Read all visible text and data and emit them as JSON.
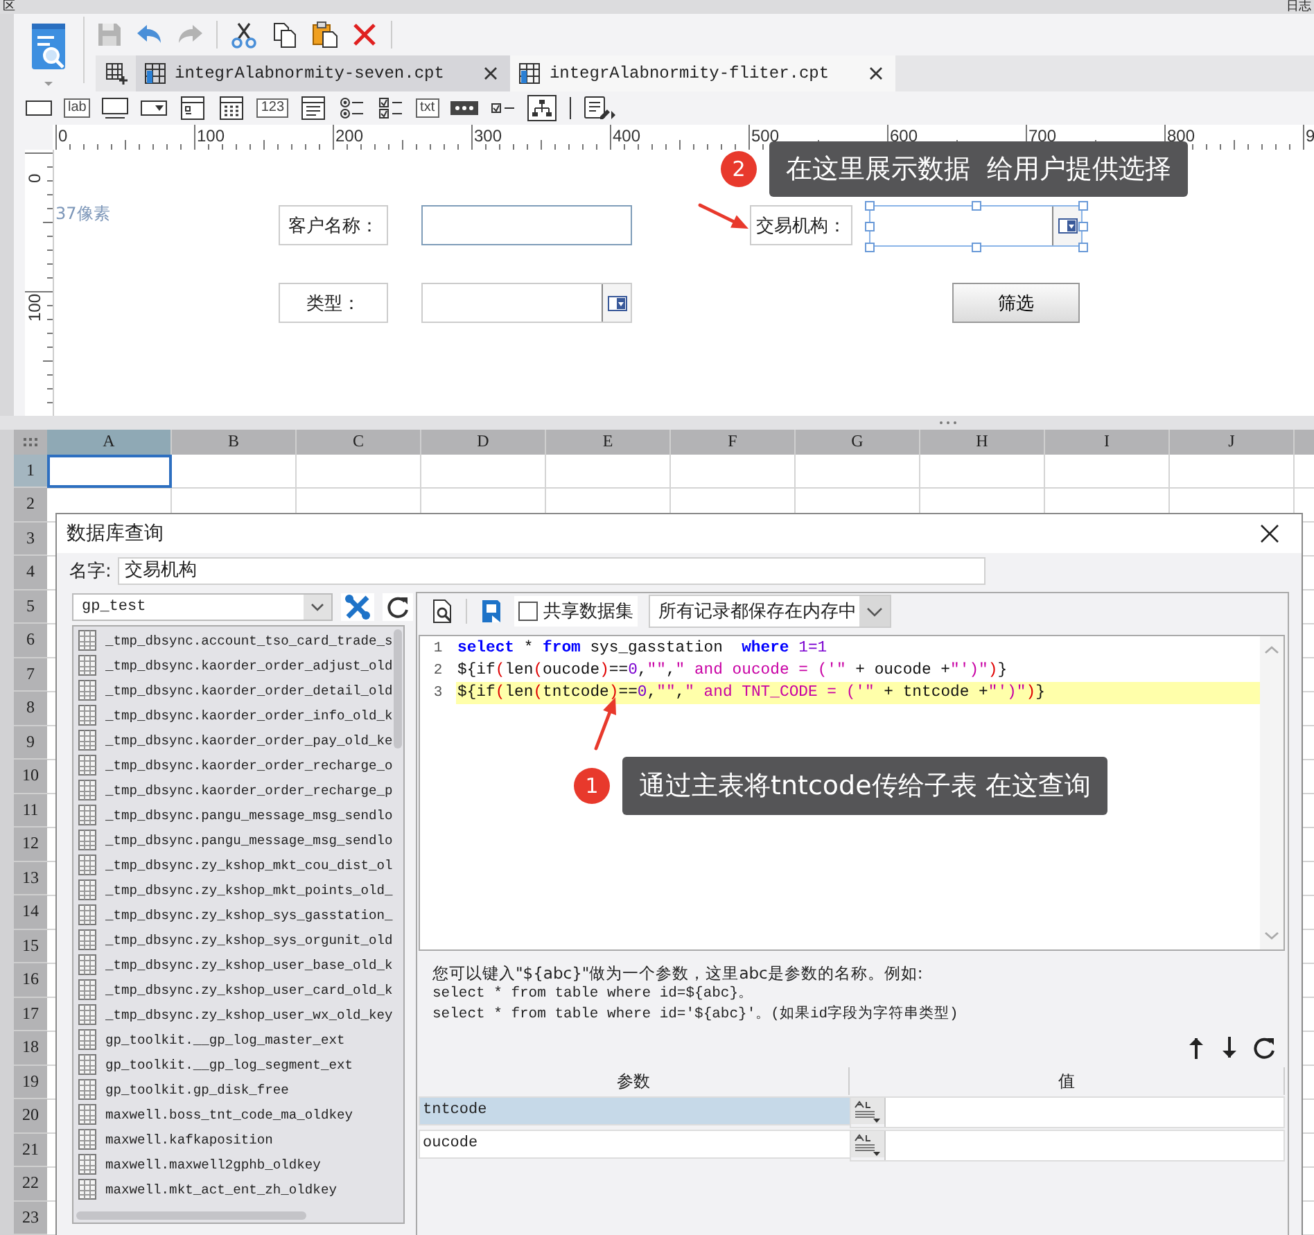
{
  "top_strip": {
    "left_text": "区",
    "right_text": "日志"
  },
  "main_toolbar": [
    {
      "kind": "save",
      "disabled": true
    },
    {
      "kind": "undo",
      "disabled": false
    },
    {
      "kind": "redo",
      "disabled": true
    },
    {
      "kind": "cut",
      "disabled": false
    },
    {
      "kind": "copy",
      "disabled": false
    },
    {
      "kind": "paste",
      "disabled": false
    },
    {
      "kind": "delete",
      "disabled": false
    }
  ],
  "file_tabs": [
    {
      "label": "integrAlabnormity-seven.cpt",
      "selected": false
    },
    {
      "label": "integrAlabnormity-fliter.cpt",
      "selected": true
    }
  ],
  "widget_toolbar": [
    {
      "kind": "text-field"
    },
    {
      "kind": "label",
      "label": "lab"
    },
    {
      "kind": "text-area"
    },
    {
      "kind": "combo"
    },
    {
      "kind": "date-panel"
    },
    {
      "kind": "calendar"
    },
    {
      "kind": "number",
      "label": "123"
    },
    {
      "kind": "list"
    },
    {
      "kind": "radio-group"
    },
    {
      "kind": "checkbox-group"
    },
    {
      "kind": "text",
      "label": "txt"
    },
    {
      "kind": "password"
    },
    {
      "kind": "checkbox"
    },
    {
      "kind": "tree"
    },
    {
      "kind": "separator"
    },
    {
      "kind": "form-edit"
    }
  ],
  "ruler": {
    "x_labels": [
      "0",
      "100",
      "200",
      "300",
      "400",
      "500",
      "600",
      "700",
      "800",
      "9"
    ],
    "y_labels": [
      "0",
      "100"
    ]
  },
  "canvas": {
    "note": "37像素",
    "widgets": [
      {
        "kind": "label",
        "text": "客户名称："
      },
      {
        "kind": "text-field",
        "selected": false
      },
      {
        "kind": "label",
        "text": "类型："
      },
      {
        "kind": "combo",
        "selected": false
      },
      {
        "kind": "label",
        "text": "交易机构："
      },
      {
        "kind": "combo",
        "selected": true
      },
      {
        "kind": "button",
        "text": "筛选"
      }
    ]
  },
  "annotations": [
    {
      "number": "2",
      "text": "在这里展示数据  给用户提供选择"
    },
    {
      "number": "1",
      "text": "通过主表将tntcode传给子表 在这查询"
    }
  ],
  "sheet": {
    "columns": [
      {
        "label": "A",
        "selected": true
      },
      {
        "label": "B",
        "selected": false
      },
      {
        "label": "C",
        "selected": false
      },
      {
        "label": "D",
        "selected": false
      },
      {
        "label": "E",
        "selected": false
      },
      {
        "label": "F",
        "selected": false
      },
      {
        "label": "G",
        "selected": false
      },
      {
        "label": "H",
        "selected": false
      },
      {
        "label": "I",
        "selected": false
      },
      {
        "label": "J",
        "selected": false
      }
    ],
    "rows": [
      {
        "label": "1",
        "selected": true
      },
      {
        "label": "2",
        "selected": false
      },
      {
        "label": "3",
        "selected": false
      },
      {
        "label": "4",
        "selected": false
      },
      {
        "label": "5",
        "selected": false
      },
      {
        "label": "6",
        "selected": false
      },
      {
        "label": "7",
        "selected": false
      },
      {
        "label": "8",
        "selected": false
      },
      {
        "label": "9",
        "selected": false
      },
      {
        "label": "10",
        "selected": false
      },
      {
        "label": "11",
        "selected": false
      },
      {
        "label": "12",
        "selected": false
      },
      {
        "label": "13",
        "selected": false
      },
      {
        "label": "14",
        "selected": false
      },
      {
        "label": "15",
        "selected": false
      },
      {
        "label": "16",
        "selected": false
      },
      {
        "label": "17",
        "selected": false
      },
      {
        "label": "18",
        "selected": false
      },
      {
        "label": "19",
        "selected": false
      },
      {
        "label": "20",
        "selected": false
      },
      {
        "label": "21",
        "selected": false
      },
      {
        "label": "22",
        "selected": false
      },
      {
        "label": "23",
        "selected": false
      }
    ]
  },
  "dialog": {
    "title": "数据库查询",
    "name_label": "名字:",
    "name_value": "交易机构",
    "connection": "gp_test",
    "tables": [
      "_tmp_dbsync.account_tso_card_trade_s",
      "_tmp_dbsync.kaorder_order_adjust_old",
      "_tmp_dbsync.kaorder_order_detail_old",
      "_tmp_dbsync.kaorder_order_info_old_k",
      "_tmp_dbsync.kaorder_order_pay_old_ke",
      "_tmp_dbsync.kaorder_order_recharge_o",
      "_tmp_dbsync.kaorder_order_recharge_p",
      "_tmp_dbsync.pangu_message_msg_sendlo",
      "_tmp_dbsync.pangu_message_msg_sendlo",
      "_tmp_dbsync.zy_kshop_mkt_cou_dist_ol",
      "_tmp_dbsync.zy_kshop_mkt_points_old_",
      "_tmp_dbsync.zy_kshop_sys_gasstation_",
      "_tmp_dbsync.zy_kshop_sys_orgunit_old",
      "_tmp_dbsync.zy_kshop_user_base_old_k",
      "_tmp_dbsync.zy_kshop_user_card_old_k",
      "_tmp_dbsync.zy_kshop_user_wx_old_key",
      "gp_toolkit.__gp_log_master_ext",
      "gp_toolkit.__gp_log_segment_ext",
      "gp_toolkit.gp_disk_free",
      "maxwell.boss_tnt_code_ma_oldkey",
      "maxwell.kafkaposition",
      "maxwell.maxwell2gphb_oldkey",
      "maxwell.mkt_act_ent_zh_oldkey"
    ],
    "shared_dataset": {
      "label": "共享数据集",
      "checked": false
    },
    "cache_mode": "所有记录都保存在内存中",
    "sql_lines": [
      {
        "number": "1",
        "highlighted": false,
        "tokens": [
          {
            "kind": "keyword",
            "text": "select"
          },
          {
            "kind": "plain",
            "text": " * "
          },
          {
            "kind": "keyword",
            "text": "from"
          },
          {
            "kind": "plain",
            "text": " sys_gasstation  "
          },
          {
            "kind": "keyword",
            "text": "where"
          },
          {
            "kind": "number",
            "text": " 1=1"
          }
        ]
      },
      {
        "number": "2",
        "highlighted": false,
        "tokens": [
          {
            "kind": "plain",
            "text": "${if"
          },
          {
            "kind": "paren",
            "text": "("
          },
          {
            "kind": "plain",
            "text": "len"
          },
          {
            "kind": "paren",
            "text": "("
          },
          {
            "kind": "plain",
            "text": "oucode"
          },
          {
            "kind": "paren",
            "text": ")"
          },
          {
            "kind": "plain",
            "text": "=="
          },
          {
            "kind": "number",
            "text": "0"
          },
          {
            "kind": "plain",
            "text": ","
          },
          {
            "kind": "string",
            "text": "\"\""
          },
          {
            "kind": "plain",
            "text": ","
          },
          {
            "kind": "string",
            "text": "\" and oucode = ('\""
          },
          {
            "kind": "plain",
            "text": " + oucode +"
          },
          {
            "kind": "string",
            "text": "\"')\""
          },
          {
            "kind": "paren",
            "text": ")"
          },
          {
            "kind": "plain",
            "text": "}"
          }
        ]
      },
      {
        "number": "3",
        "highlighted": true,
        "tokens": [
          {
            "kind": "plain",
            "text": "${if"
          },
          {
            "kind": "paren",
            "text": "("
          },
          {
            "kind": "plain",
            "text": "len"
          },
          {
            "kind": "paren",
            "text": "("
          },
          {
            "kind": "plain",
            "text": "tntcode"
          },
          {
            "kind": "paren",
            "text": ")"
          },
          {
            "kind": "plain",
            "text": "=="
          },
          {
            "kind": "number",
            "text": "0"
          },
          {
            "kind": "plain",
            "text": ","
          },
          {
            "kind": "string",
            "text": "\"\""
          },
          {
            "kind": "plain",
            "text": ","
          },
          {
            "kind": "string",
            "text": "\" and TNT_CODE = ('\""
          },
          {
            "kind": "plain",
            "text": " + tntcode +"
          },
          {
            "kind": "string",
            "text": "\"')\""
          },
          {
            "kind": "paren",
            "text": ")"
          },
          {
            "kind": "plain",
            "text": "}"
          }
        ]
      }
    ],
    "help_lines": [
      "您可以键入\"${abc}\"做为一个参数，这里abc是参数的名称。例如:",
      "select * from table where id=${abc}。",
      "select * from table where id='${abc}'。(如果id字段为字符串类型)"
    ],
    "params": {
      "columns": [
        "参数",
        "值"
      ],
      "rows": [
        {
          "name": "tntcode",
          "selected": true
        },
        {
          "name": "oucode",
          "selected": false
        }
      ]
    }
  }
}
